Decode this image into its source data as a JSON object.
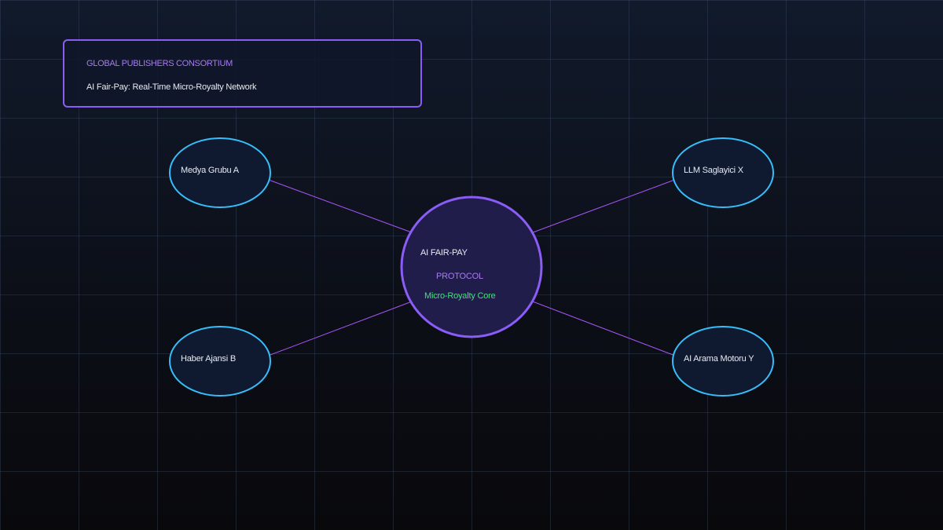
{
  "header": {
    "org": "GLOBAL PUBLISHERS CONSORTIUM",
    "title": "AI Fair-Pay: Real-Time Micro-Royalty Network"
  },
  "hub": {
    "line1": "AI FAIR-PAY",
    "line2": "PROTOCOL",
    "line3": "Micro-Royalty Core"
  },
  "nodes": [
    {
      "id": "medya-grubu-a",
      "label": "Medya Grubu A"
    },
    {
      "id": "llm-saglayici-x",
      "label": "LLM Saglayici X"
    },
    {
      "id": "haber-ajansi-b",
      "label": "Haber Ajansi B"
    },
    {
      "id": "ai-arama-motoru-y",
      "label": "AI Arama Motoru Y"
    }
  ],
  "edges": [
    {
      "from": "medya-grubu-a",
      "to": "hub"
    },
    {
      "from": "llm-saglayici-x",
      "to": "hub"
    },
    {
      "from": "haber-ajansi-b",
      "to": "hub"
    },
    {
      "from": "ai-arama-motoru-y",
      "to": "hub"
    }
  ],
  "colors": {
    "accent_purple": "#8b5cf6",
    "hub_fill": "#211d4b",
    "node_stroke": "#38bdf8",
    "node_fill": "#0f1a30",
    "edge": "#a855f7",
    "label_purple": "#a77bf3",
    "label_green": "#4ade80",
    "text_light": "#e8ebf2"
  }
}
